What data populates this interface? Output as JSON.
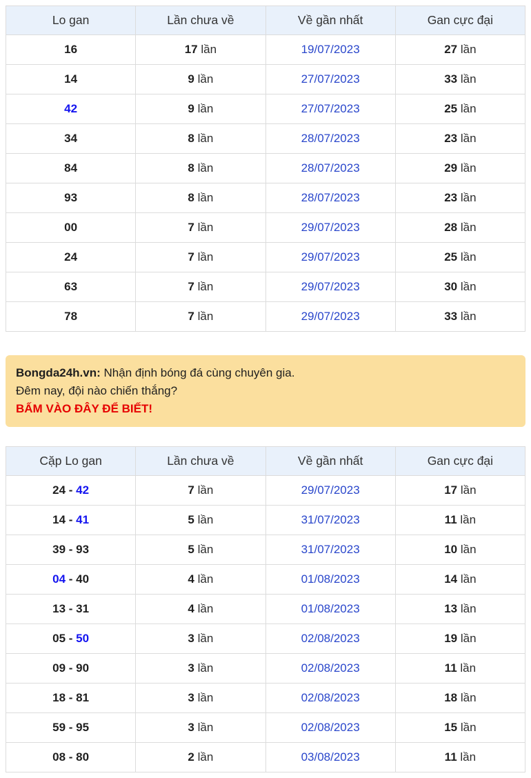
{
  "labels": {
    "unit": "lần",
    "pair_sep": " - "
  },
  "colors": {
    "header_bg": "#e9f1fb",
    "border": "#dcdcdc",
    "date_blue": "#2946cb",
    "highlight_blue": "#1414f0",
    "promo_bg": "#fbdf9e",
    "promo_red": "#e60000"
  },
  "table_lo_gan": {
    "headers": [
      "Lo gan",
      "Lần chưa về",
      "Về gần nhất",
      "Gan cực đại"
    ],
    "rows": [
      {
        "number": "16",
        "blue": false,
        "times": "17",
        "date": "19/07/2023",
        "max": "27"
      },
      {
        "number": "14",
        "blue": false,
        "times": "9",
        "date": "27/07/2023",
        "max": "33"
      },
      {
        "number": "42",
        "blue": true,
        "times": "9",
        "date": "27/07/2023",
        "max": "25"
      },
      {
        "number": "34",
        "blue": false,
        "times": "8",
        "date": "28/07/2023",
        "max": "23"
      },
      {
        "number": "84",
        "blue": false,
        "times": "8",
        "date": "28/07/2023",
        "max": "29"
      },
      {
        "number": "93",
        "blue": false,
        "times": "8",
        "date": "28/07/2023",
        "max": "23"
      },
      {
        "number": "00",
        "blue": false,
        "times": "7",
        "date": "29/07/2023",
        "max": "28"
      },
      {
        "number": "24",
        "blue": false,
        "times": "7",
        "date": "29/07/2023",
        "max": "25"
      },
      {
        "number": "63",
        "blue": false,
        "times": "7",
        "date": "29/07/2023",
        "max": "30"
      },
      {
        "number": "78",
        "blue": false,
        "times": "7",
        "date": "29/07/2023",
        "max": "33"
      }
    ]
  },
  "promo": {
    "brand": "Bongda24h.vn:",
    "line1_rest": " Nhận định bóng đá cùng chuyên gia.",
    "line2": "Đêm nay, đội nào chiến thắng?",
    "cta": "BẤM VÀO ĐÂY ĐỂ BIẾT!"
  },
  "table_cap_lo_gan": {
    "headers": [
      "Cặp Lo gan",
      "Lần chưa về",
      "Về gần nhất",
      "Gan cực đại"
    ],
    "rows": [
      {
        "a": "24",
        "a_blue": false,
        "b": "42",
        "b_blue": true,
        "times": "7",
        "date": "29/07/2023",
        "max": "17"
      },
      {
        "a": "14",
        "a_blue": false,
        "b": "41",
        "b_blue": true,
        "times": "5",
        "date": "31/07/2023",
        "max": "11"
      },
      {
        "a": "39",
        "a_blue": false,
        "b": "93",
        "b_blue": false,
        "times": "5",
        "date": "31/07/2023",
        "max": "10"
      },
      {
        "a": "04",
        "a_blue": true,
        "b": "40",
        "b_blue": false,
        "times": "4",
        "date": "01/08/2023",
        "max": "14"
      },
      {
        "a": "13",
        "a_blue": false,
        "b": "31",
        "b_blue": false,
        "times": "4",
        "date": "01/08/2023",
        "max": "13"
      },
      {
        "a": "05",
        "a_blue": false,
        "b": "50",
        "b_blue": true,
        "times": "3",
        "date": "02/08/2023",
        "max": "19"
      },
      {
        "a": "09",
        "a_blue": false,
        "b": "90",
        "b_blue": false,
        "times": "3",
        "date": "02/08/2023",
        "max": "11"
      },
      {
        "a": "18",
        "a_blue": false,
        "b": "81",
        "b_blue": false,
        "times": "3",
        "date": "02/08/2023",
        "max": "18"
      },
      {
        "a": "59",
        "a_blue": false,
        "b": "95",
        "b_blue": false,
        "times": "3",
        "date": "02/08/2023",
        "max": "15"
      },
      {
        "a": "08",
        "a_blue": false,
        "b": "80",
        "b_blue": false,
        "times": "2",
        "date": "03/08/2023",
        "max": "11"
      }
    ]
  }
}
